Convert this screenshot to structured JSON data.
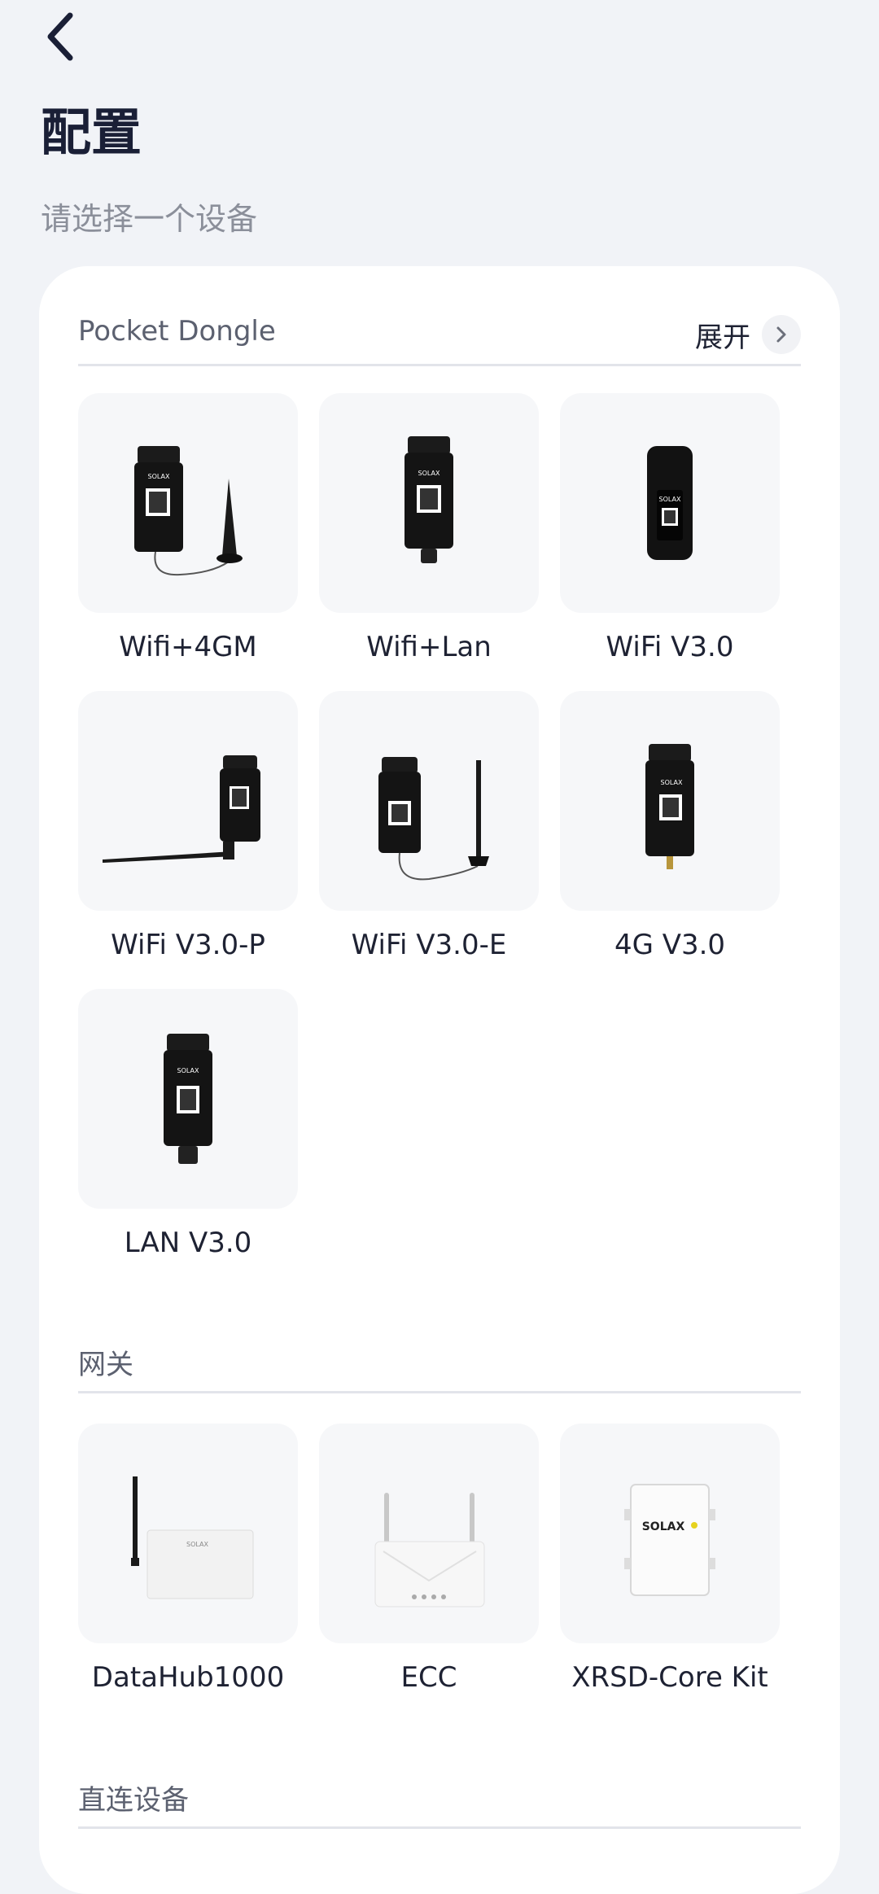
{
  "header": {
    "title": "配置",
    "subtitle": "请选择一个设备"
  },
  "sections": [
    {
      "title": "Pocket Dongle",
      "expand_label": "展开",
      "items": [
        {
          "label": "Wifi+4GM",
          "image": "dongle-with-antenna"
        },
        {
          "label": "Wifi+Lan",
          "image": "dongle-lan"
        },
        {
          "label": "WiFi V3.0",
          "image": "dongle-wifi"
        },
        {
          "label": "WiFi V3.0-P",
          "image": "dongle-long-antenna"
        },
        {
          "label": "WiFi V3.0-E",
          "image": "dongle-with-antenna"
        },
        {
          "label": "4G V3.0",
          "image": "dongle-4g"
        },
        {
          "label": "LAN V3.0",
          "image": "dongle-lan"
        }
      ]
    },
    {
      "title": "网关",
      "items": [
        {
          "label": "DataHub1000",
          "image": "datahub-box"
        },
        {
          "label": "ECC",
          "image": "router-white"
        },
        {
          "label": "XRSD-Core Kit",
          "image": "enclosure-box"
        }
      ]
    },
    {
      "title": "直连设备",
      "items": []
    }
  ],
  "brand_text": "SOLAX"
}
